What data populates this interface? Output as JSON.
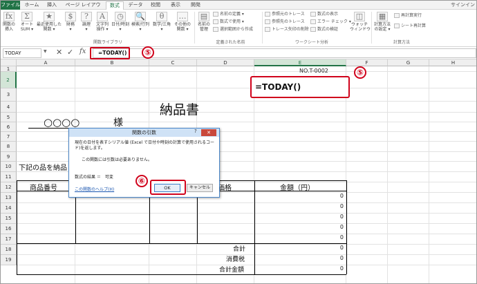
{
  "tabs": [
    "ファイル",
    "ホーム",
    "挿入",
    "ページ レイアウト",
    "数式",
    "データ",
    "校閲",
    "表示",
    "開発"
  ],
  "active_tab": "数式",
  "user": "サインイン",
  "ribbon": {
    "buttons": [
      {
        "label": "関数の\n挿入",
        "icon": "fx"
      },
      {
        "label": "オート\nSUM ▾",
        "icon": "Σ"
      },
      {
        "label": "最近使用した\n関数 ▾",
        "icon": "★"
      },
      {
        "label": "財務\n▾",
        "icon": "$"
      },
      {
        "label": "論理\n▾",
        "icon": "?"
      },
      {
        "label": "文字列\n操作 ▾",
        "icon": "A"
      },
      {
        "label": "日付/時刻\n▾",
        "icon": "◷"
      },
      {
        "label": "検索/行列\n▾",
        "icon": "🔍"
      },
      {
        "label": "数学/三角\n▾",
        "icon": "θ"
      },
      {
        "label": "その他の\n関数 ▾",
        "icon": "…"
      },
      {
        "label": "名前の\n管理",
        "icon": "▤"
      },
      {
        "label": "ウォッチ\nウィンドウ",
        "icon": "◫"
      },
      {
        "label": "計算方法\nの設定 ▾",
        "icon": "▦"
      }
    ],
    "small": [
      "名前の定義 ▾",
      "数式で使用 ▾",
      "選択範囲から作成",
      "参照元のトレース",
      "参照先のトレース",
      "トレース矢印の削除 ▾",
      "数式の表示",
      "エラー チェック ▾",
      "数式の検証",
      "再計算実行",
      "シート再計算"
    ],
    "groups": [
      "関数ライブラリ",
      "定義された名前",
      "ワークシート分析",
      "計算方法"
    ]
  },
  "formula_bar": {
    "name_box": "TODAY",
    "cancel": "✕",
    "enter": "✓",
    "fx": "fx",
    "formula": "=TODAY()"
  },
  "columns": [
    "A",
    "B",
    "C",
    "D",
    "E",
    "F",
    "G",
    "H"
  ],
  "rows": [
    "1",
    "2",
    "3",
    "4",
    "5",
    "6",
    "7",
    "8",
    "9",
    "10",
    "11",
    "12",
    "13",
    "14",
    "15",
    "16",
    "17",
    "18",
    "19"
  ],
  "sheet": {
    "doc_no": "NO.T-0002",
    "cell_formula": "=TODAY()",
    "title": "納品書",
    "customer": "○○○○",
    "honorific": "様",
    "intro": "下記の品を納品",
    "headers": {
      "product": "商品番号",
      "price": "価格",
      "amount": "金額（円）"
    },
    "zero": "0",
    "subtotal": "合計",
    "tax": "消費税",
    "total": "合計金額"
  },
  "steps": {
    "five": "⑤",
    "six": "⑥"
  },
  "dialog": {
    "title": "関数の引数",
    "help_btn": "?",
    "close_btn": "✕",
    "description": "現在の日付を表すシリアル値 (Excel で日付や時刻の計算で使用されるコード)を返します。",
    "no_args": "この関数には引数は必要ありません。",
    "result": "数式の結果 ＝　可変",
    "help_link": "この関数のヘルプ(H)",
    "ok": "OK",
    "cancel": "キャンセル"
  }
}
